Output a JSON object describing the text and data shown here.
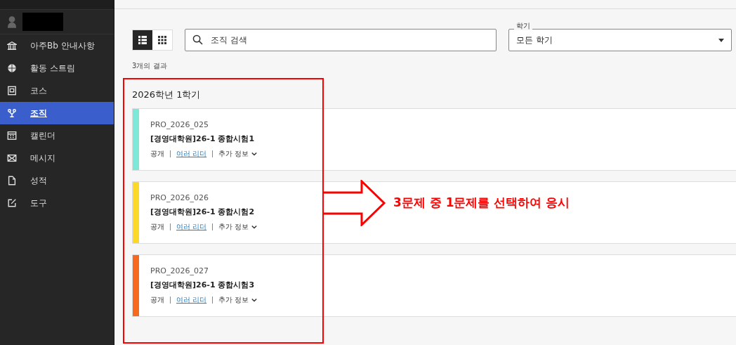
{
  "sidebar": {
    "items": [
      {
        "label": "아주Bb 안내사항",
        "selected": false
      },
      {
        "label": "활동 스트림",
        "selected": false
      },
      {
        "label": "코스",
        "selected": false
      },
      {
        "label": "조직",
        "selected": true
      },
      {
        "label": "캘린더",
        "selected": false
      },
      {
        "label": "메시지",
        "selected": false
      },
      {
        "label": "성적",
        "selected": false
      },
      {
        "label": "도구",
        "selected": false
      }
    ]
  },
  "toolbar": {
    "views": [
      {
        "kind": "list",
        "selected": true
      },
      {
        "kind": "grid",
        "selected": false
      }
    ],
    "search": {
      "placeholder": "조직 검색"
    },
    "term_filter": {
      "label": "학기",
      "value": "모든 학기"
    }
  },
  "result_count": "3개의 결과",
  "group": {
    "title": "2026학년 1학기",
    "courses": [
      {
        "id": "PRO_2026_025",
        "title": "[경영대학원]26-1 종합시험1",
        "status": "공개",
        "leader": "여러 리더",
        "more": "추가 정보",
        "color": "#7de8d8"
      },
      {
        "id": "PRO_2026_026",
        "title": "[경영대학원]26-1 종합시험2",
        "status": "공개",
        "leader": "여러 리더",
        "more": "추가 정보",
        "color": "#fcd829"
      },
      {
        "id": "PRO_2026_027",
        "title": "[경영대학원]26-1 종합시험3",
        "status": "공개",
        "leader": "여러 리더",
        "more": "추가 정보",
        "color": "#f76a1d"
      }
    ]
  },
  "annotation": {
    "text": "3문제 중 1문제를 선택하여 응시"
  }
}
